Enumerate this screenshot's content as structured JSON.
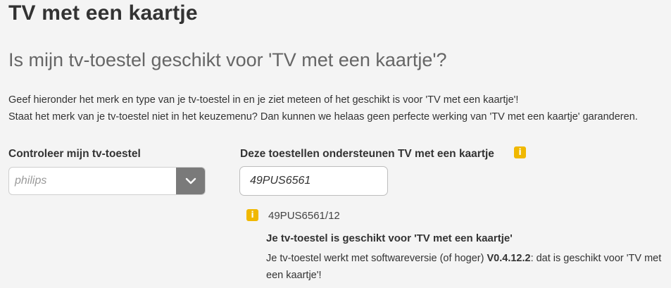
{
  "header": {
    "title": "TV met een kaartje",
    "subtitle": "Is mijn tv-toestel geschikt voor 'TV met een kaartje'?"
  },
  "intro": {
    "line1": "Geef hieronder het merk en type van je tv-toestel in en je ziet meteen of het geschikt is voor 'TV met een kaartje'!",
    "line2": "Staat het merk van je tv-toestel niet in het keuzemenu? Dan kunnen we helaas geen perfecte werking van 'TV met een kaartje' garanderen."
  },
  "brand_check": {
    "label": "Controleer mijn tv-toestel",
    "selected_value": "philips",
    "arrow_icon": "chevron-down-icon"
  },
  "model_check": {
    "label": "Deze toestellen ondersteunen TV met een kaartje",
    "info_icon": "info-icon",
    "input_value": "49PUS6561"
  },
  "result": {
    "info_icon": "info-icon",
    "model": "49PUS6561/12",
    "title": "Je tv-toestel is geschikt voor 'TV met een kaartje'",
    "text_before": "Je tv-toestel werkt met softwareversie (of hoger) ",
    "version": "V0.4.12.2",
    "text_after": ": dat is geschikt voor 'TV met een kaartje'!"
  },
  "colors": {
    "background": "#f4f4f4",
    "info_yellow": "#f0b800",
    "select_arrow_bg": "#7a7a7a"
  }
}
